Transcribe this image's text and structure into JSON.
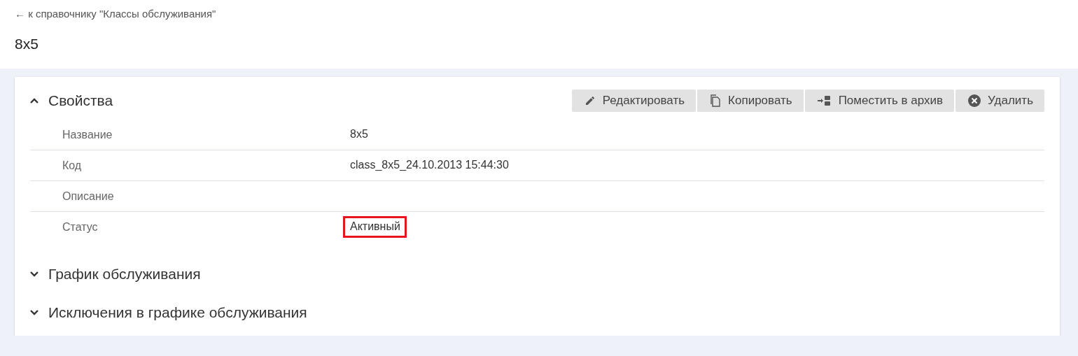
{
  "back_link": "← к справочнику \"Классы обслуживания\"",
  "title": "8x5",
  "sections": [
    {
      "title": "Свойства",
      "expanded": true,
      "actions": [
        {
          "kind": "edit",
          "label": "Редактировать"
        },
        {
          "kind": "copy",
          "label": "Копировать"
        },
        {
          "kind": "archive",
          "label": "Поместить в архив"
        },
        {
          "kind": "delete",
          "label": "Удалить"
        }
      ],
      "properties": [
        {
          "label": "Название",
          "value": "8x5"
        },
        {
          "label": "Код",
          "value": "class_8x5_24.10.2013 15:44:30"
        },
        {
          "label": "Описание"
        },
        {
          "label": "Статус",
          "value": "Активный",
          "highlighted": true
        }
      ]
    },
    {
      "title": "График обслуживания",
      "expanded": false
    },
    {
      "title": "Исключения в графике обслуживания",
      "expanded": false
    }
  ]
}
